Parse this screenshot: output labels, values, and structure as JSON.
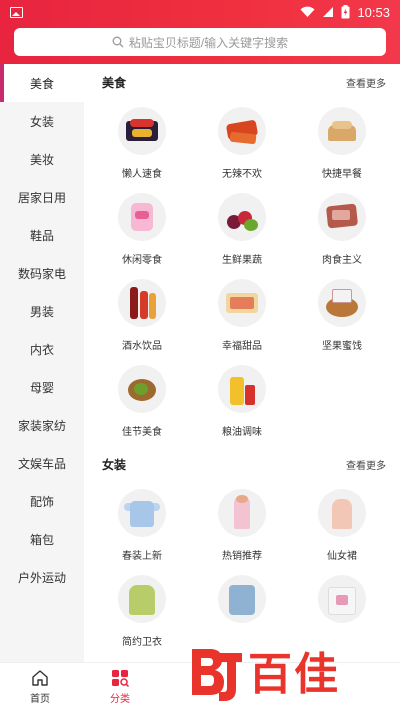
{
  "status_bar": {
    "time": "10:53"
  },
  "search": {
    "placeholder": "粘贴宝贝标题/输入关键字搜索"
  },
  "sidebar": {
    "items": [
      "美食",
      "女装",
      "美妆",
      "居家日用",
      "鞋品",
      "数码家电",
      "男装",
      "内衣",
      "母婴",
      "家装家纺",
      "文娱车品",
      "配饰",
      "箱包",
      "户外运动"
    ],
    "active_index": 0
  },
  "sections": [
    {
      "title": "美食",
      "more": "查看更多",
      "items": [
        "懒人速食",
        "无辣不欢",
        "快捷早餐",
        "休闲零食",
        "生鲜果蔬",
        "肉食主义",
        "酒水饮品",
        "幸福甜品",
        "坚果蜜饯",
        "佳节美食",
        "粮油调味"
      ]
    },
    {
      "title": "女装",
      "more": "查看更多",
      "items": [
        "春装上新",
        "热销推荐",
        "仙女裙",
        "简约卫衣",
        "",
        ""
      ]
    }
  ],
  "tabbar": {
    "items": [
      "首页",
      "分类",
      "",
      "",
      ""
    ],
    "active_index": 1
  },
  "watermark": {
    "text": "百佳"
  },
  "colors": {
    "accent": "#e8243f",
    "sidebar_marker": "#c82a6e",
    "watermark": "#e8342a"
  }
}
